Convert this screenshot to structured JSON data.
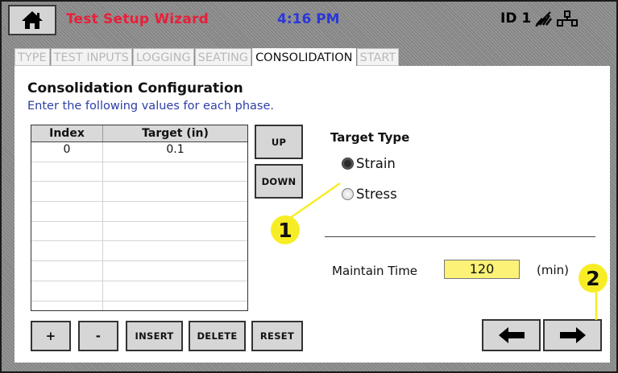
{
  "header": {
    "title": "Test Setup Wizard",
    "time": "4:16 PM",
    "device_id": "ID 1",
    "icons": [
      "home-icon",
      "no-signal-icon",
      "network-icon"
    ]
  },
  "tabs": [
    {
      "label": "TYPE",
      "active": false
    },
    {
      "label": "TEST INPUTS",
      "active": false
    },
    {
      "label": "LOGGING",
      "active": false
    },
    {
      "label": "SEATING",
      "active": false
    },
    {
      "label": "CONSOLIDATION",
      "active": true
    },
    {
      "label": "START",
      "active": false
    }
  ],
  "panel": {
    "title": "Consolidation Configuration",
    "subtitle": "Enter the following values for each phase."
  },
  "table": {
    "columns": [
      "Index",
      "Target (in)"
    ],
    "rows": [
      [
        "0",
        "0.1"
      ]
    ]
  },
  "buttons": {
    "up": "UP",
    "down": "DOWN",
    "add": "+",
    "remove": "-",
    "insert": "INSERT",
    "delete": "DELETE",
    "reset": "RESET"
  },
  "target_type": {
    "label": "Target Type",
    "options": [
      {
        "label": "Strain",
        "selected": true
      },
      {
        "label": "Stress",
        "selected": false
      }
    ]
  },
  "maintain_time": {
    "label": "Maintain Time",
    "value": "120",
    "unit": "(min)"
  },
  "callouts": [
    "1",
    "2"
  ],
  "colors": {
    "title": "#e8203a",
    "time": "#2a38d8",
    "input_bg": "#fbf277",
    "callout": "#f7ed26"
  }
}
